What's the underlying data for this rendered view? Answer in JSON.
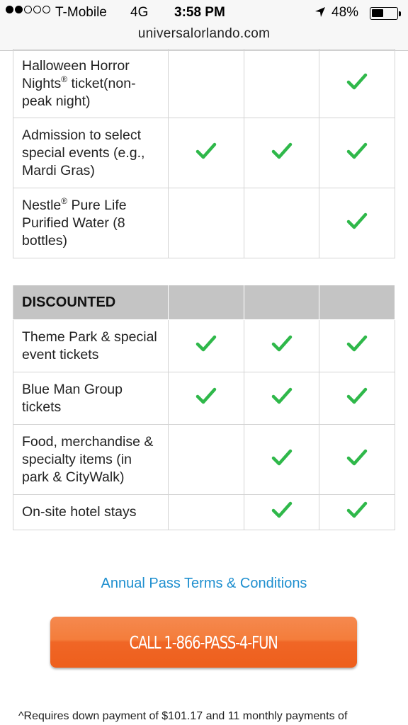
{
  "status_bar": {
    "carrier": "T-Mobile",
    "network": "4G",
    "time": "3:58 PM",
    "battery": "48%",
    "battery_level": 0.48,
    "signal_bars": 2,
    "signal_total": 5
  },
  "browser": {
    "url": "universalorlando.com"
  },
  "icons": {
    "location": "location-arrow-icon",
    "check": "checkmark-icon"
  },
  "colors": {
    "check": "#2fb84a",
    "link": "#1e8fcf",
    "cta": "#f06626",
    "section_header": "#c4c4c4"
  },
  "benefits_table": {
    "rows": [
      {
        "label": "Halloween Horror Nights",
        "sup": "®",
        "label_rest": " ticket(non-peak night)",
        "checks": [
          false,
          false,
          true
        ]
      },
      {
        "label": "Admission to select special events (e.g., Mardi Gras)",
        "sup": "",
        "label_rest": "",
        "checks": [
          true,
          true,
          true
        ]
      },
      {
        "label": "Nestle",
        "sup": "®",
        "label_rest": " Pure Life Purified Water (8 bottles)",
        "checks": [
          false,
          false,
          true
        ]
      }
    ]
  },
  "discounted_table": {
    "header": "DISCOUNTED",
    "rows": [
      {
        "label": "Theme Park & special event tickets",
        "checks": [
          true,
          true,
          true
        ]
      },
      {
        "label": "Blue Man Group tickets",
        "checks": [
          true,
          true,
          true
        ]
      },
      {
        "label": "Food, merchandise & specialty items (in park & CityWalk)",
        "checks": [
          false,
          true,
          true
        ]
      },
      {
        "label": "On-site hotel stays",
        "checks": [
          false,
          true,
          true
        ]
      }
    ]
  },
  "terms_link": "Annual Pass Terms & Conditions",
  "cta_label": "CALL 1-866-PASS-4-FUN",
  "footnote": "^Requires down payment of $101.17 and 11 monthly payments of"
}
